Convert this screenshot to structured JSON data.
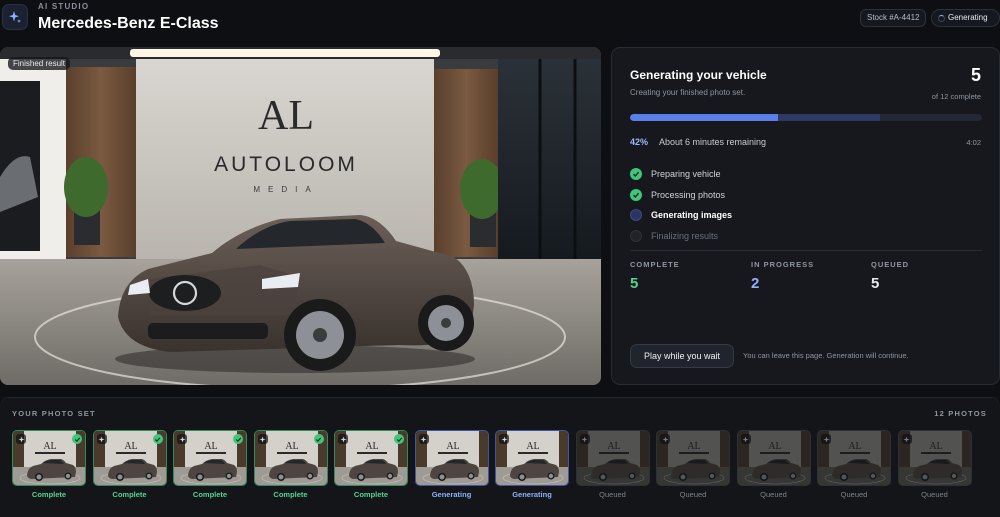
{
  "header": {
    "app_label": "AI STUDIO",
    "title": "Mercedes-Benz E-Class",
    "stock": "Stock #A-4412",
    "status": "Generating",
    "app_icon": "sparkle-icon"
  },
  "hero": {
    "tag": "Finished result",
    "logo_mark": "AL",
    "logo_name": "AUTOLOOM",
    "logo_sub": "MEDIA"
  },
  "panel": {
    "title": "Generating your vehicle",
    "subtitle": "Creating your finished photo set.",
    "count": "5",
    "count_of": "of 12 complete",
    "progress_complete": 0.42,
    "progress_in_progress": 0.58,
    "percent": "42%",
    "remaining": "About 6 minutes remaining",
    "elapsed": "4:02",
    "steps": [
      {
        "label": "Preparing vehicle",
        "state": "done"
      },
      {
        "label": "Processing photos",
        "state": "done"
      },
      {
        "label": "Generating images",
        "state": "active"
      },
      {
        "label": "Finalizing results",
        "state": "pending"
      }
    ],
    "stats": {
      "complete_label": "COMPLETE",
      "complete_value": "5",
      "progress_label": "IN PROGRESS",
      "progress_value": "2",
      "queued_label": "QUEUED",
      "queued_value": "5"
    },
    "play_button": "Play while you wait",
    "play_note": "You can leave this page. Generation will continue."
  },
  "photo_set": {
    "label": "YOUR PHOTO SET",
    "count": "12 PHOTOS",
    "photos": [
      {
        "status": "Complete",
        "state": "complete"
      },
      {
        "status": "Complete",
        "state": "complete"
      },
      {
        "status": "Complete",
        "state": "complete"
      },
      {
        "status": "Complete",
        "state": "complete"
      },
      {
        "status": "Complete",
        "state": "complete"
      },
      {
        "status": "Generating",
        "state": "generating"
      },
      {
        "status": "Generating",
        "state": "generating"
      },
      {
        "status": "Queued",
        "state": "queued"
      },
      {
        "status": "Queued",
        "state": "queued"
      },
      {
        "status": "Queued",
        "state": "queued"
      },
      {
        "status": "Queued",
        "state": "queued"
      },
      {
        "status": "Queued",
        "state": "queued"
      }
    ]
  },
  "colors": {
    "accent": "#5b7fe8",
    "complete": "#56d390",
    "in_progress": "#8fb0ff",
    "background": "#0d0f13"
  }
}
